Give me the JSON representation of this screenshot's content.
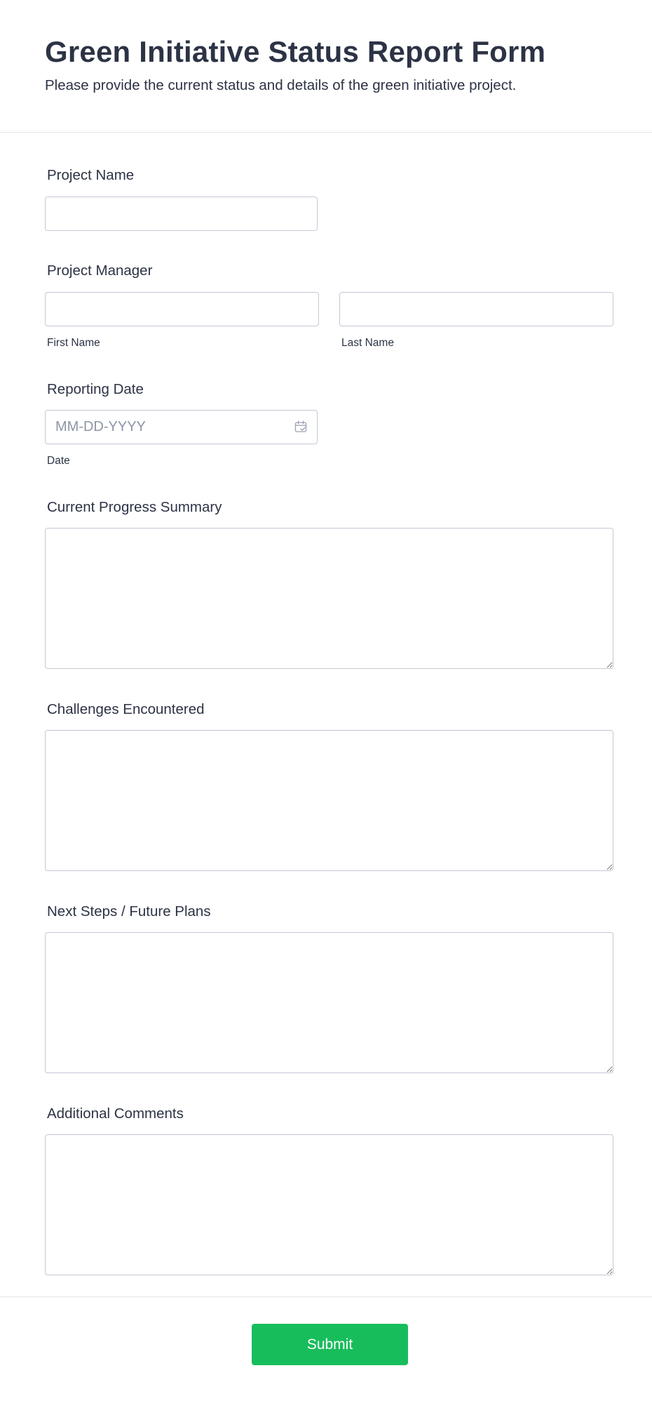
{
  "header": {
    "title": "Green Initiative Status Report Form",
    "subtitle": "Please provide the current status and details of the green initiative project."
  },
  "fields": {
    "project_name": {
      "label": "Project Name",
      "value": ""
    },
    "project_manager": {
      "label": "Project Manager",
      "first_name_value": "",
      "first_name_sublabel": "First Name",
      "last_name_value": "",
      "last_name_sublabel": "Last Name"
    },
    "reporting_date": {
      "label": "Reporting Date",
      "placeholder": "MM-DD-YYYY",
      "sublabel": "Date",
      "icon": "calendar-icon"
    },
    "current_progress": {
      "label": "Current Progress Summary",
      "value": ""
    },
    "challenges": {
      "label": "Challenges Encountered",
      "value": ""
    },
    "next_steps": {
      "label": "Next Steps / Future Plans",
      "value": ""
    },
    "additional_comments": {
      "label": "Additional Comments",
      "value": ""
    }
  },
  "footer": {
    "submit_label": "Submit"
  },
  "colors": {
    "text": "#2c3345",
    "border": "#c3c8d3",
    "placeholder": "#8d96a6",
    "submit_bg": "#18bd5b",
    "divider": "#e3e5ea"
  }
}
